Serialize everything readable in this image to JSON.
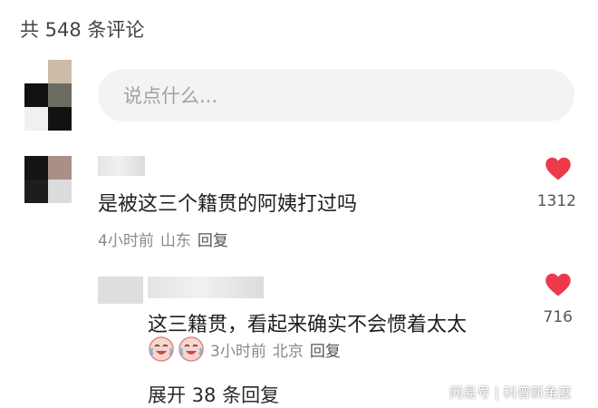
{
  "header": {
    "comment_count_label": "共 548 条评论"
  },
  "input": {
    "placeholder": "说点什么..."
  },
  "comments": [
    {
      "text": "是被这三个籍贯的阿姨打过吗",
      "time": "4小时前",
      "location": "山东",
      "reply_label": "回复",
      "likes": "1312"
    }
  ],
  "reply": {
    "text": "这三籍贯，看起来确实不会惯着太太",
    "time": "3小时前",
    "location": "北京",
    "reply_label": "回复",
    "likes": "716",
    "emoji_icon": "crying-laughing-emoji-icon"
  },
  "expand_replies_label": "展开 38 条回复",
  "watermark": "网易号 | 科普新角度",
  "colors": {
    "heart": "#ec3a4a",
    "input_bg": "#f3f3f5",
    "meta_text": "#8a8a8a"
  }
}
